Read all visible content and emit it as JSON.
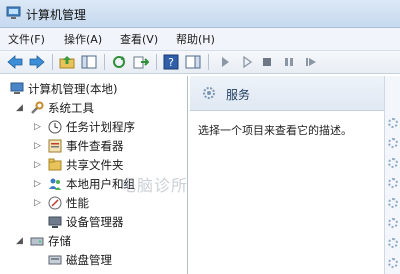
{
  "window": {
    "title": "计算机管理"
  },
  "menu": {
    "items": [
      "文件(F)",
      "操作(A)",
      "查看(V)",
      "帮助(H)"
    ]
  },
  "tree": {
    "root": "计算机管理(本地)",
    "system_tools": "系统工具",
    "items": [
      "任务计划程序",
      "事件查看器",
      "共享文件夹",
      "本地用户和组",
      "性能",
      "设备管理器"
    ],
    "storage": "存储",
    "disk": "磁盘管理"
  },
  "services": {
    "title": "服务",
    "description": "选择一个项目来查看它的描述。"
  },
  "watermark": "电脑诊所",
  "icons": {
    "back": "back-arrow-icon",
    "forward": "forward-arrow-icon",
    "up": "folder-up-icon",
    "console": "console-tree-icon",
    "refresh": "refresh-icon",
    "export": "export-list-icon",
    "help": "help-icon",
    "pane": "show-pane-icon",
    "play": "play-icon",
    "play2": "play-outline-icon",
    "stop": "stop-icon",
    "pause": "pause-icon",
    "restart": "restart-icon"
  }
}
